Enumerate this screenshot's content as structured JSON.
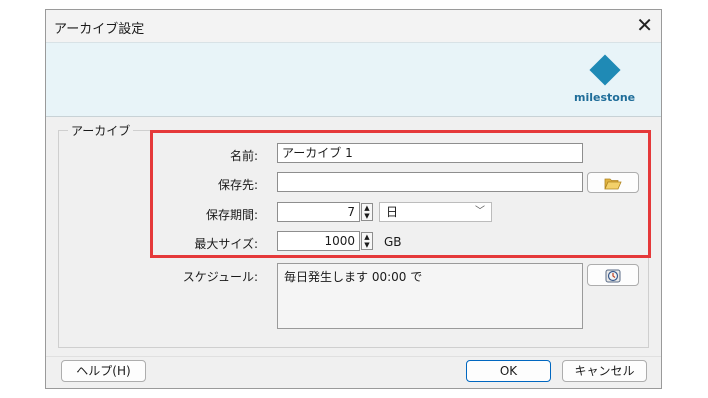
{
  "window": {
    "title": "アーカイブ設定",
    "close_glyph": "✕"
  },
  "brand": {
    "logo_text": "milestone",
    "accent": "#1f8ab5"
  },
  "group": {
    "label": "アーカイブ"
  },
  "fields": {
    "name": {
      "label": "名前:",
      "value": "アーカイブ 1"
    },
    "save_to": {
      "label": "保存先:",
      "value": ""
    },
    "retention": {
      "label": "保存期間:",
      "value": "7",
      "unit": "日"
    },
    "max_size": {
      "label": "最大サイズ:",
      "value": "1000",
      "unit": "GB"
    },
    "schedule": {
      "label": "スケジュール:",
      "value": "毎日発生します 00:00 で"
    }
  },
  "buttons": {
    "help": "ヘルプ(H)",
    "ok": "OK",
    "cancel": "キャンセル"
  },
  "icons": {
    "folder": "folder-open-icon",
    "schedule": "clock-calendar-icon",
    "spin_up": "▲",
    "spin_down": "▼",
    "chevron": "﹀"
  },
  "highlight_color": "#e5393a"
}
